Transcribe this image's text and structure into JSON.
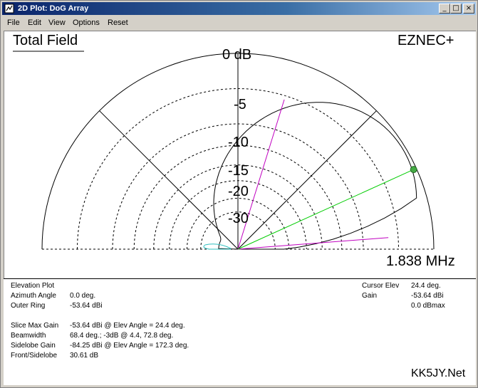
{
  "window": {
    "title": "2D Plot: DoG Array"
  },
  "titlebar_buttons": {
    "minimize": "_",
    "maximize": "□",
    "close": "×"
  },
  "menu": {
    "items": [
      {
        "label": "File"
      },
      {
        "label": "Edit"
      },
      {
        "label": "View"
      },
      {
        "label": "Options"
      },
      {
        "label": "Reset"
      }
    ]
  },
  "plot": {
    "title": "Total Field",
    "brand": "EZNEC+",
    "frequency": "1.838 MHz",
    "ring_labels": [
      "0 dB",
      "-5",
      "-10",
      "-15",
      "-20",
      "-30"
    ],
    "colors": {
      "pattern": "#000000",
      "beam": "#c000c0",
      "cursor": "#00cc00",
      "cursor_dot": "#44aa44",
      "rear_lobe": "#30c0c0"
    }
  },
  "info": {
    "plot_type": "Elevation Plot",
    "azimuth_label": "Azimuth Angle",
    "azimuth_value": "0.0 deg.",
    "outer_ring_label": "Outer Ring",
    "outer_ring_value": "-53.64 dBi",
    "slice_max_label": "Slice Max Gain",
    "slice_max_value": "-53.64 dBi @ Elev Angle = 24.4 deg.",
    "beamwidth_label": "Beamwidth",
    "beamwidth_value": "68.4 deg.; -3dB @ 4.4, 72.8 deg.",
    "sidelobe_label": "Sidelobe Gain",
    "sidelobe_value": "-84.25 dBi @ Elev Angle = 172.3 deg.",
    "fs_label": "Front/Sidelobe",
    "fs_value": "30.61 dB",
    "cursor_elev_label": "Cursor Elev",
    "cursor_elev_value": "24.4 deg.",
    "gain_label": "Gain",
    "gain_value": "-53.64 dBi",
    "gain_max_value": "0.0 dBmax",
    "credit": "KK5JY.Net"
  }
}
